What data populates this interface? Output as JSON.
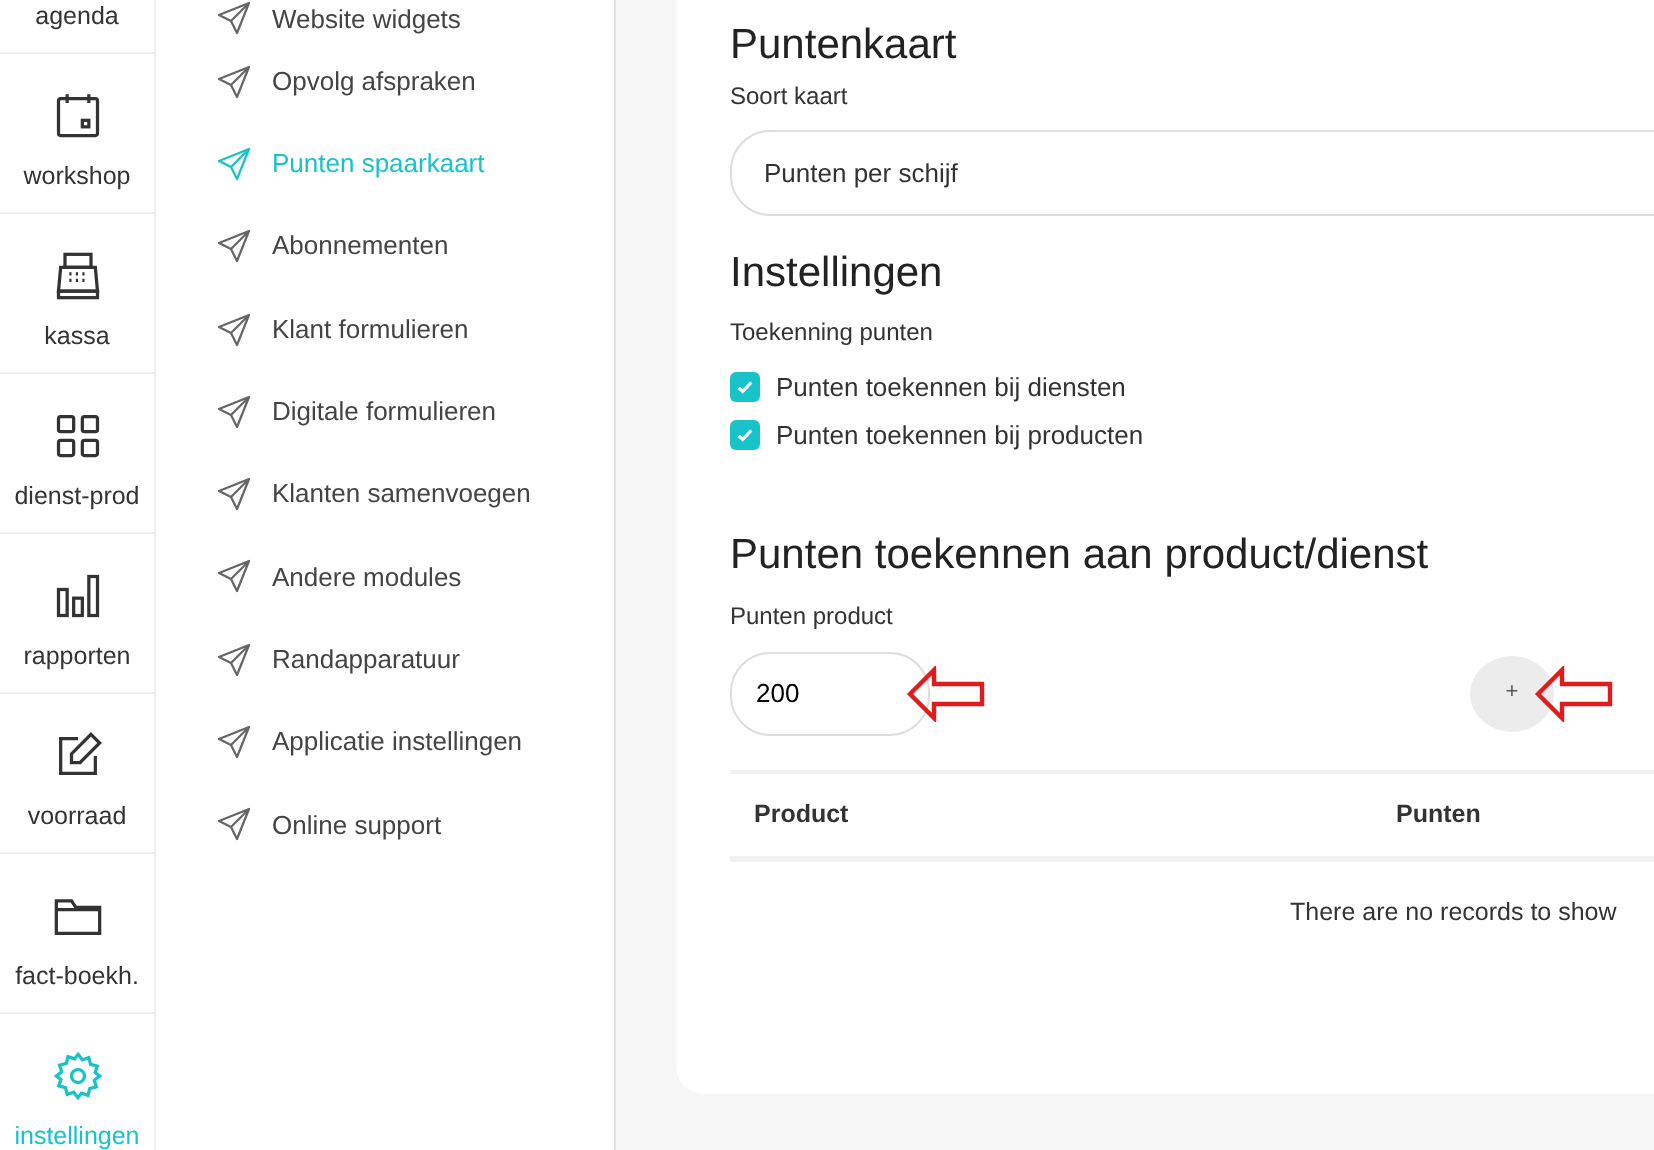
{
  "rail": [
    {
      "label": "agenda",
      "selected": false
    },
    {
      "label": "workshop",
      "selected": false
    },
    {
      "label": "kassa",
      "selected": false
    },
    {
      "label": "dienst-prod",
      "selected": false
    },
    {
      "label": "rapporten",
      "selected": false
    },
    {
      "label": "voorraad",
      "selected": false
    },
    {
      "label": "fact-boekh.",
      "selected": false
    },
    {
      "label": "instellingen",
      "selected": true
    }
  ],
  "submenu": [
    {
      "label": "Website widgets",
      "selected": false
    },
    {
      "label": "Opvolg afspraken",
      "selected": false
    },
    {
      "label": "Punten spaarkaart",
      "selected": true
    },
    {
      "label": "Abonnementen",
      "selected": false
    },
    {
      "label": "Klant formulieren",
      "selected": false
    },
    {
      "label": "Digitale formulieren",
      "selected": false
    },
    {
      "label": "Klanten samenvoegen",
      "selected": false
    },
    {
      "label": "Andere modules",
      "selected": false
    },
    {
      "label": "Randapparatuur",
      "selected": false
    },
    {
      "label": "Applicatie instellingen",
      "selected": false
    },
    {
      "label": "Online support",
      "selected": false
    }
  ],
  "card_type": {
    "title": "Puntenkaart",
    "label": "Soort kaart",
    "value": "Punten per schijf"
  },
  "settings": {
    "title": "Instellingen",
    "label": "Toekenning punten",
    "options": [
      {
        "label": "Punten toekennen bij diensten",
        "checked": true
      },
      {
        "label": "Punten toekennen bij producten",
        "checked": true
      }
    ]
  },
  "assign": {
    "title": "Punten toekennen aan product/dienst",
    "label": "Punten product",
    "value": "200",
    "add_button": "+",
    "table": {
      "columns": [
        "Product",
        "Punten"
      ],
      "empty_text": "There are no records to show"
    }
  }
}
